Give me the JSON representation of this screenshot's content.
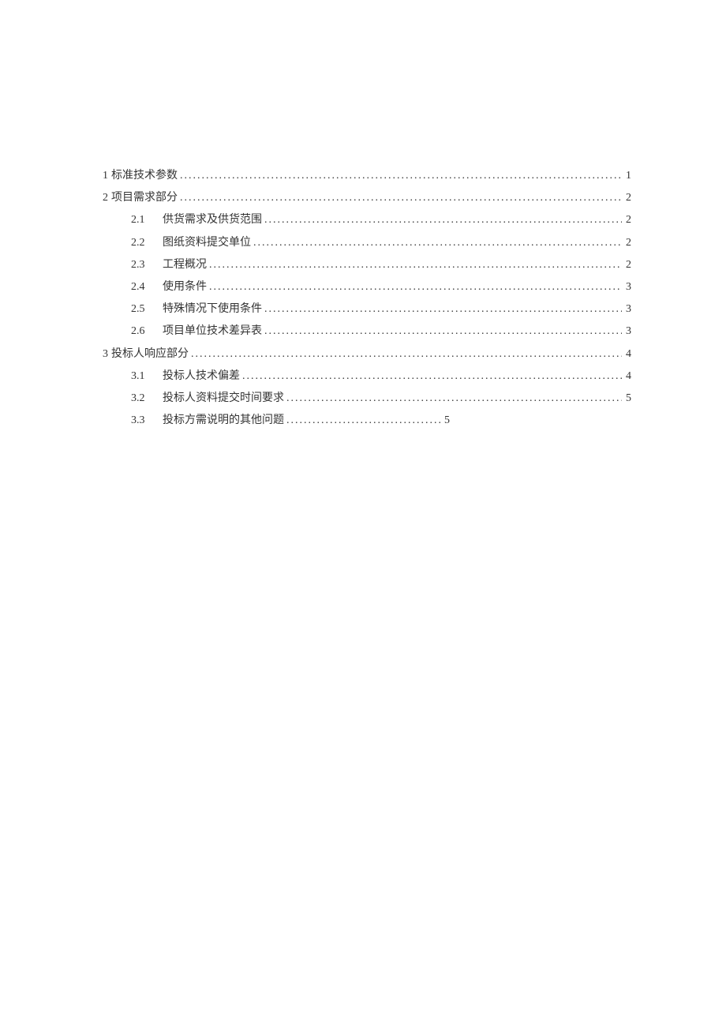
{
  "toc": {
    "entries": [
      {
        "level": 1,
        "number": "1",
        "title": "标准技术参数",
        "page": "1"
      },
      {
        "level": 1,
        "number": "2",
        "title": "项目需求部分",
        "page": "2"
      },
      {
        "level": 2,
        "number": "2.1",
        "title": "供货需求及供货范围",
        "page": "2"
      },
      {
        "level": 2,
        "number": "2.2",
        "title": "图纸资料提交单位",
        "page": "2"
      },
      {
        "level": 2,
        "number": "2.3",
        "title": "工程概况",
        "page": "2"
      },
      {
        "level": 2,
        "number": "2.4",
        "title": "使用条件",
        "page": "3"
      },
      {
        "level": 2,
        "number": "2.5",
        "title": "特殊情况下使用条件",
        "page": "3"
      },
      {
        "level": 2,
        "number": "2.6",
        "title": "项目单位技术差异表",
        "page": "3"
      },
      {
        "level": 1,
        "number": "3",
        "title": "投标人响应部分",
        "page": "4"
      },
      {
        "level": 2,
        "number": "3.1",
        "title": "投标人技术偏差",
        "page": "4"
      },
      {
        "level": 2,
        "number": "3.2",
        "title": "投标人资料提交时间要求",
        "page": "5"
      },
      {
        "level": 2,
        "number": "3.3",
        "title": "投标方需说明的其他问题",
        "page": "5"
      }
    ]
  }
}
